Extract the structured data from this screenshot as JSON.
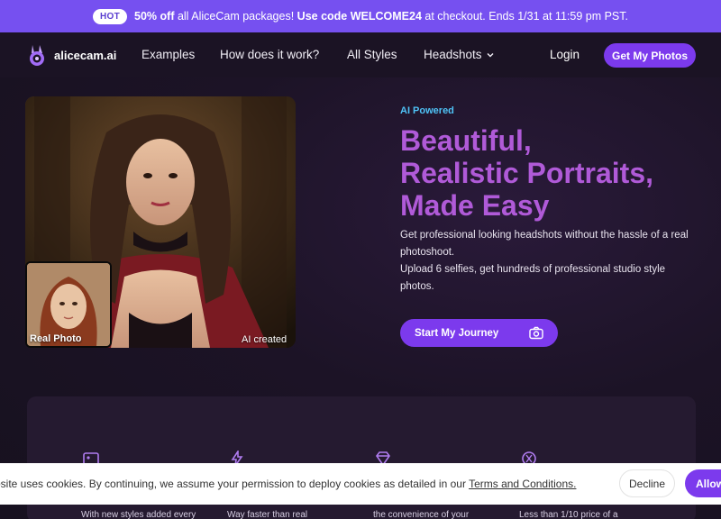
{
  "promo": {
    "badge": "HOT",
    "text_bold1": "50% off",
    "text1": " all AliceCam packages! ",
    "text_bold2": "Use code WELCOME24",
    "text2": " at checkout. Ends 1/31 at 11:59 pm PST."
  },
  "nav": {
    "brand": "alicecam.ai",
    "links": [
      "Examples",
      "How does it work?",
      "All Styles",
      "Headshots"
    ],
    "login": "Login",
    "cta": "Get My Photos"
  },
  "hero": {
    "eyebrow": "AI Powered",
    "headline": [
      "Beautiful,",
      "Realistic Portraits,",
      "Made Easy"
    ],
    "desc1": "Get professional looking headshots without the hassle of a real photoshoot.",
    "desc2": "Upload 6 selfies, get hundreds of professional studio style photos.",
    "cta": "Start My Journey",
    "real_label": "Real Photo",
    "ai_label": "AI created"
  },
  "features": {
    "snippets": [
      "With new styles added every",
      "Way faster than real",
      "the convenience of your",
      "Less than 1/10 price of a"
    ]
  },
  "cookie": {
    "text": "bsite uses cookies. By continuing, we assume your permission to deploy cookies as detailed in our ",
    "link": "Terms and Conditions.",
    "decline": "Decline",
    "allow": "Allow"
  },
  "colors": {
    "accent": "#7c3aed",
    "promo_bg": "#7650f0",
    "headline": "#b05ad8",
    "eyebrow": "#4fc3f7"
  }
}
